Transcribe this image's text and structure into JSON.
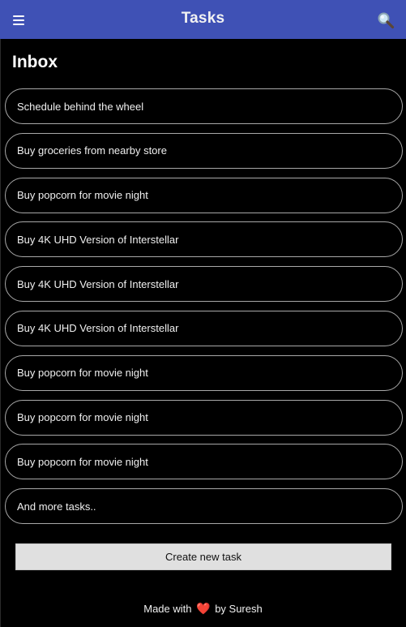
{
  "header": {
    "title": "Tasks",
    "menu_icon": "hamburger-menu-icon",
    "search_icon": "search-icon",
    "background_color": "#3f51b5"
  },
  "inbox": {
    "title": "Inbox",
    "tasks": [
      {
        "label": "Schedule behind the wheel"
      },
      {
        "label": "Buy groceries from nearby store"
      },
      {
        "label": "Buy popcorn for movie night"
      },
      {
        "label": "Buy 4K UHD Version of Interstellar"
      },
      {
        "label": "Buy 4K UHD Version of Interstellar"
      },
      {
        "label": "Buy 4K UHD Version of Interstellar"
      },
      {
        "label": "Buy popcorn for movie night"
      },
      {
        "label": "Buy popcorn for movie night"
      },
      {
        "label": "Buy popcorn for movie night"
      },
      {
        "label": "And more tasks.."
      }
    ]
  },
  "actions": {
    "create_label": "Create new task"
  },
  "footer": {
    "made_with": "Made with",
    "heart": "❤️",
    "by": "by Suresh"
  }
}
